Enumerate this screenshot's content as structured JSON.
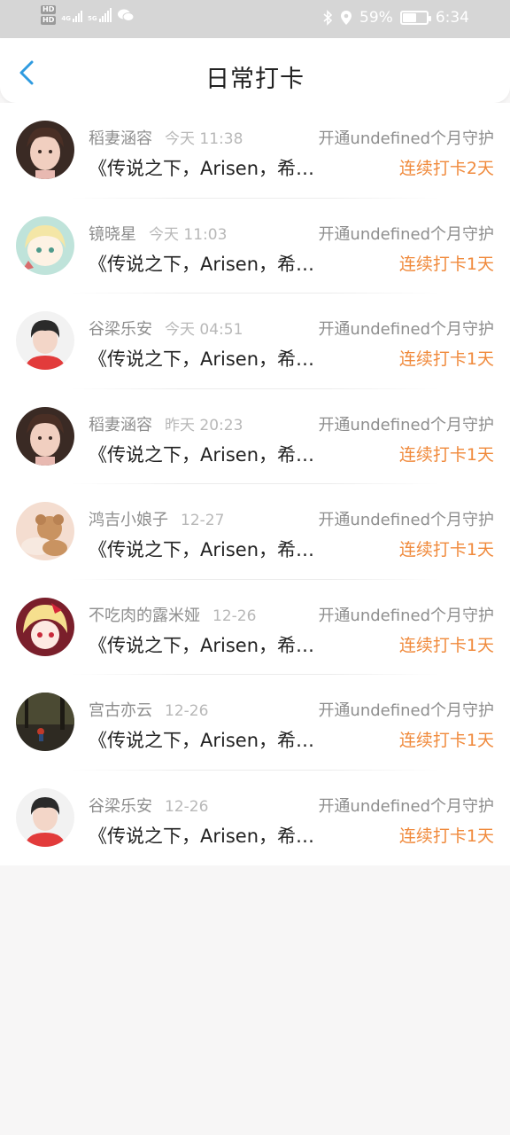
{
  "status_bar": {
    "sim1": "HD",
    "sim2": "HD",
    "net1": "4G",
    "net2": "5G",
    "battery_percent": "59%",
    "battery_level": 0.59,
    "time": "6:34"
  },
  "header": {
    "title": "日常打卡",
    "back_icon": "chevron-left-icon"
  },
  "colors": {
    "accent": "#2f9be0",
    "streak": "#f08a3c"
  },
  "checkins": [
    {
      "name": "稻妻涵容",
      "time": "今天 11:38",
      "guard": "开通undefined个月守护",
      "content": "《传说之下，Arisen，希望重新开始》",
      "streak": "连续打卡2天"
    },
    {
      "name": "镜晓星",
      "time": "今天 11:03",
      "guard": "开通undefined个月守护",
      "content": "《传说之下，Arisen，希望重新开始》",
      "streak": "连续打卡1天"
    },
    {
      "name": "谷梁乐安",
      "time": "今天 04:51",
      "guard": "开通undefined个月守护",
      "content": "《传说之下，Arisen，希望重新开始》",
      "streak": "连续打卡1天"
    },
    {
      "name": "稻妻涵容",
      "time": "昨天 20:23",
      "guard": "开通undefined个月守护",
      "content": "《传说之下，Arisen，希望重新开始》",
      "streak": "连续打卡1天"
    },
    {
      "name": "鸿吉小娘子",
      "time": "12-27",
      "guard": "开通undefined个月守护",
      "content": "《传说之下，Arisen，希望重新开始》",
      "streak": "连续打卡1天"
    },
    {
      "name": "不吃肉的露米娅",
      "time": "12-26",
      "guard": "开通undefined个月守护",
      "content": "《传说之下，Arisen，希望重新开始》",
      "streak": "连续打卡1天"
    },
    {
      "name": "宫古亦云",
      "time": "12-26",
      "guard": "开通undefined个月守护",
      "content": "《传说之下，Arisen，希望重新开始》",
      "streak": "连续打卡1天"
    },
    {
      "name": "谷梁乐安",
      "time": "12-26",
      "guard": "开通undefined个月守护",
      "content": "《传说之下，Arisen，希望重新开始》",
      "streak": "连续打卡1天"
    }
  ]
}
